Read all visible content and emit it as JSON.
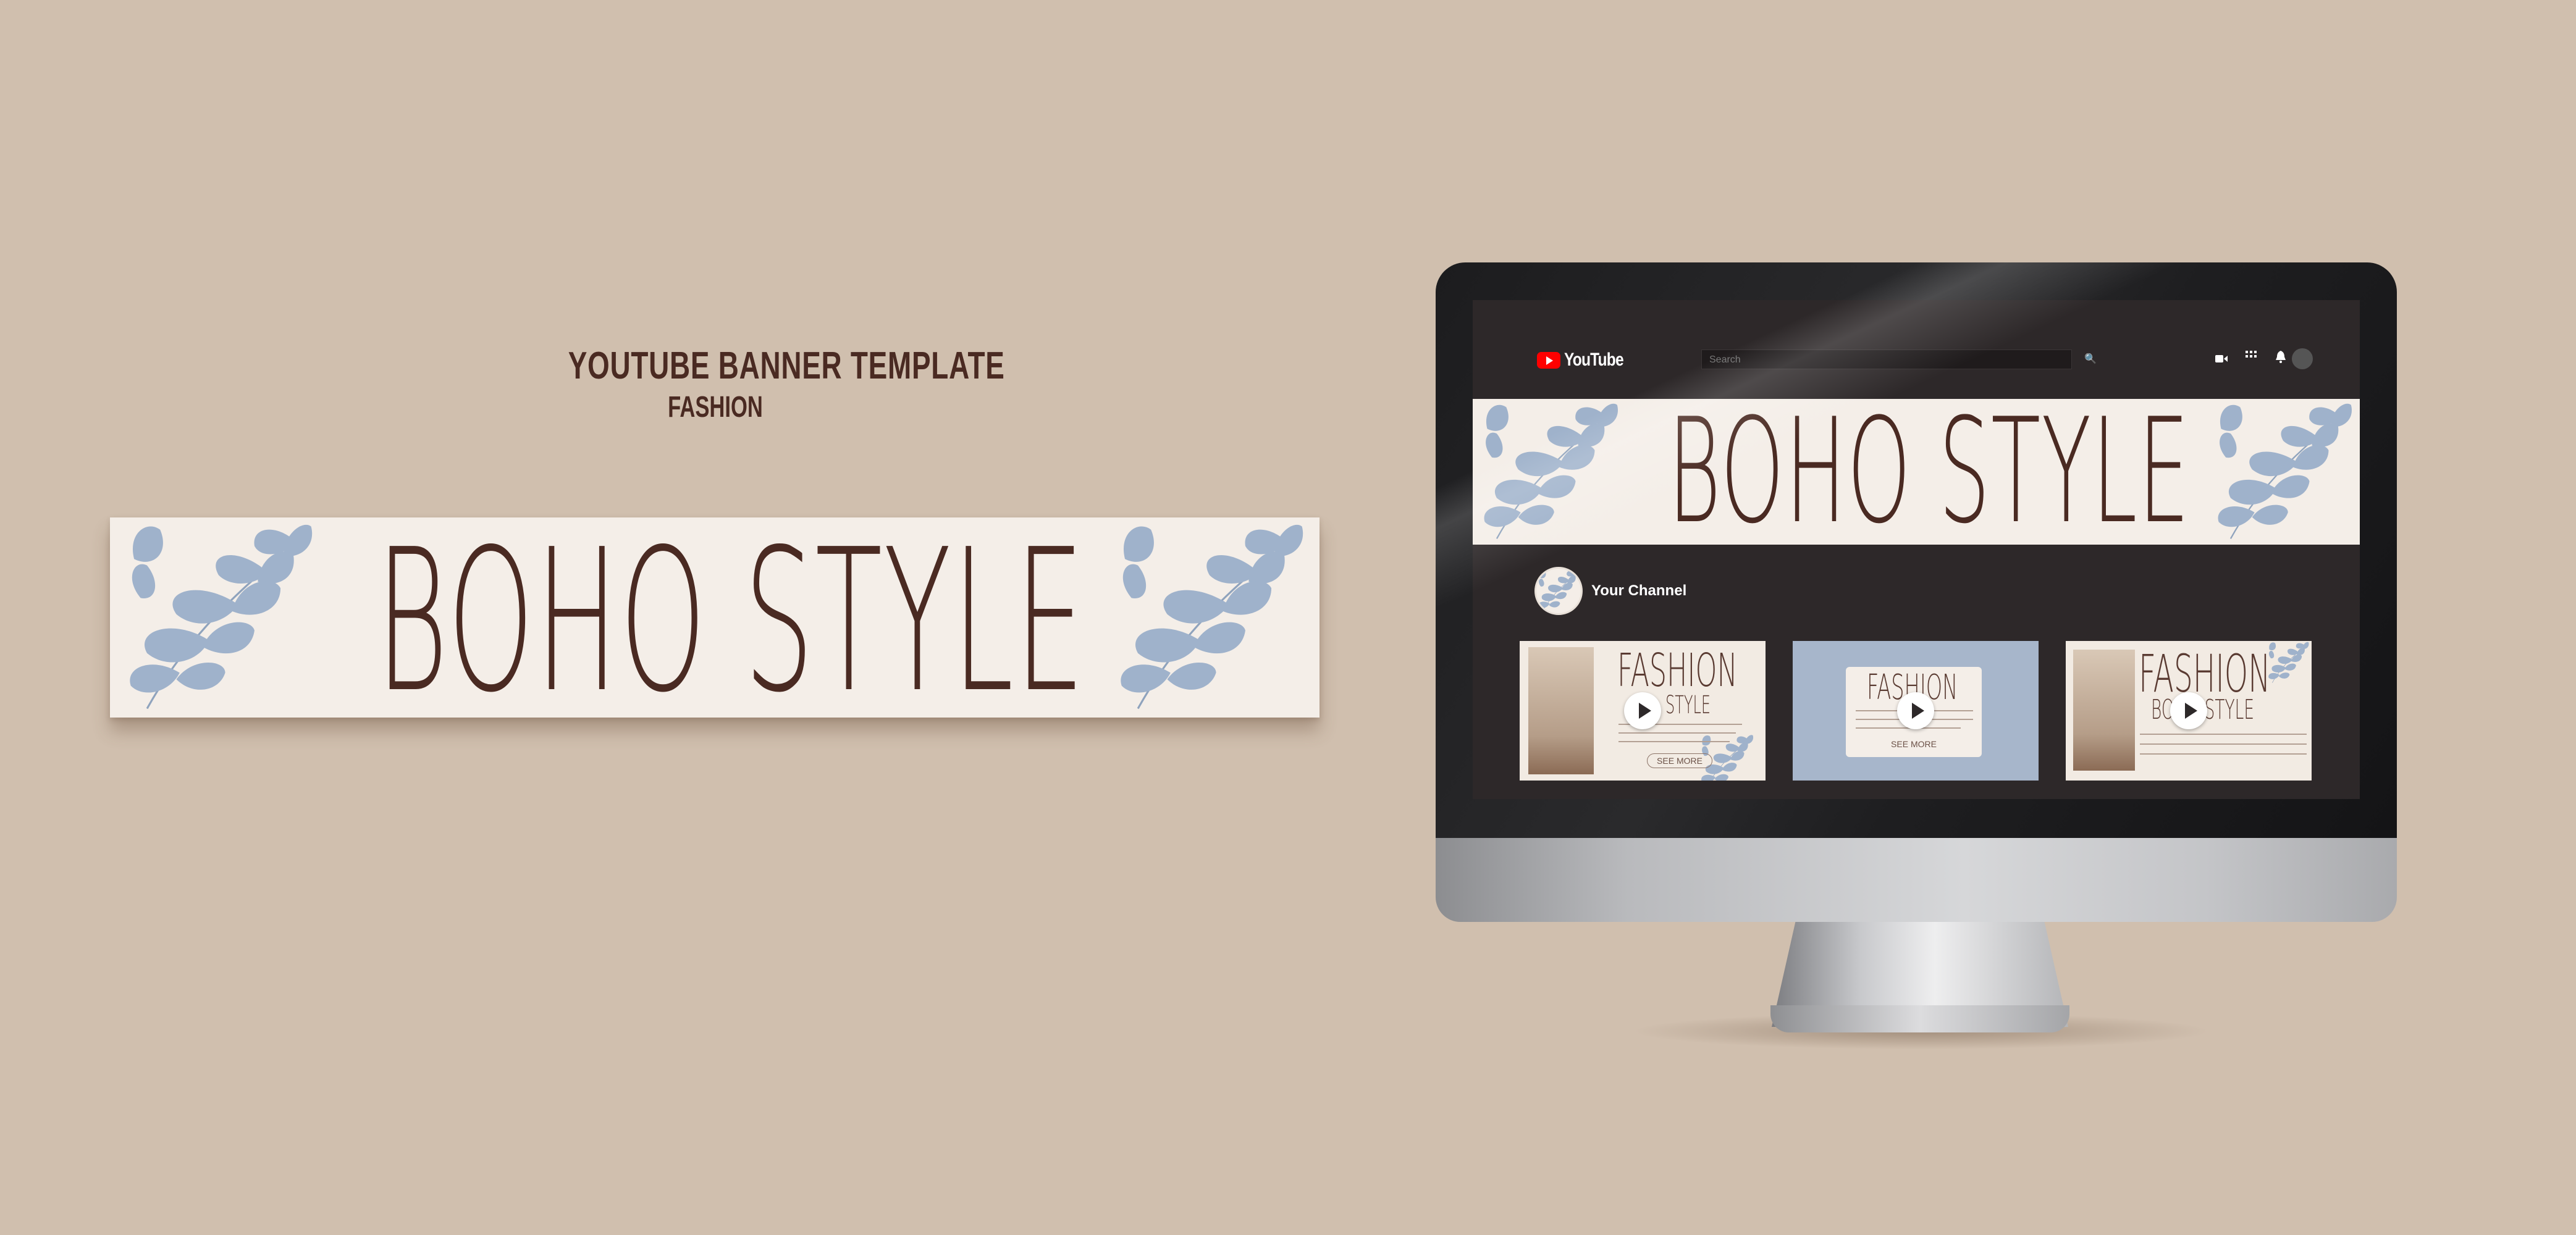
{
  "heading": {
    "title": "YOUTUBE BANNER TEMPLATE",
    "subtitle": "FASHION"
  },
  "banner": {
    "text": "BOHO STYLE",
    "colors": {
      "background": "#f4eee8",
      "text": "#4a2a22",
      "leaf": "#9fb2cb"
    }
  },
  "youtube": {
    "logo_text": "YouTube",
    "search_placeholder": "Search",
    "icons": [
      "search-icon",
      "create-video-icon",
      "apps-icon",
      "notifications-icon",
      "account-avatar"
    ],
    "channel_name": "Your Channel",
    "thumbnails": [
      {
        "title_line1": "FASHION",
        "title_line2": "STYLE",
        "button": "SEE MORE"
      },
      {
        "title_line1": "FASHION",
        "button": "SEE MORE"
      },
      {
        "title_line1": "FASHION",
        "title_line2": "BOHO STYLE"
      }
    ]
  },
  "colors": {
    "page_background": "#d0bfae",
    "screen_background": "#2d2829",
    "heading": "#4a2a22",
    "youtube_red": "#ff0000"
  }
}
